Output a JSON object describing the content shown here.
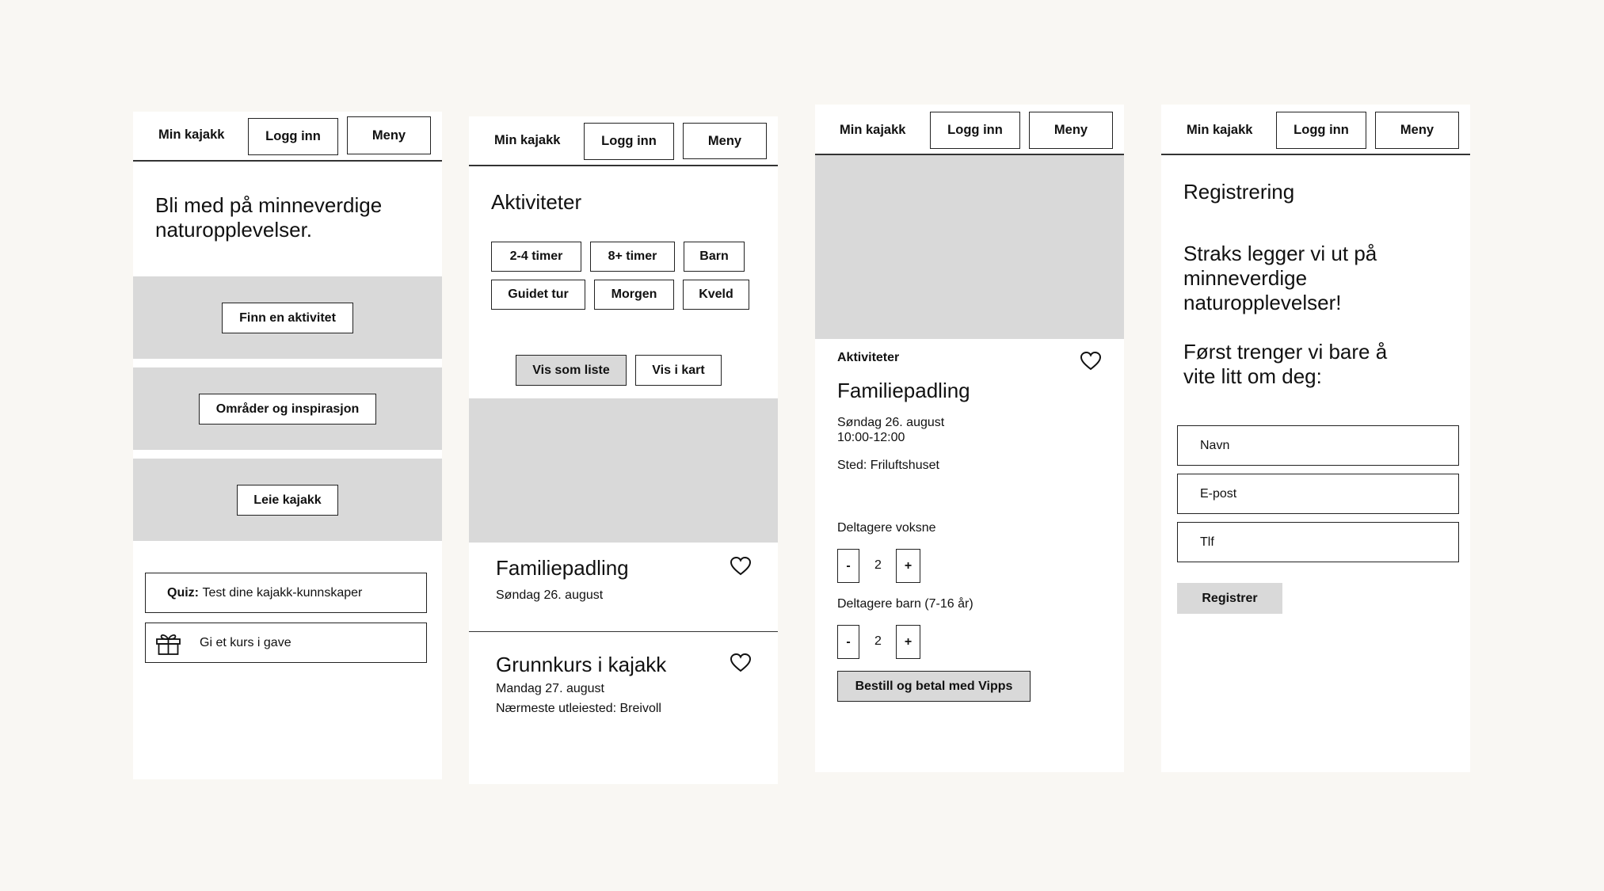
{
  "header": {
    "brand": "Min kajakk",
    "login": "Logg inn",
    "menu": "Meny"
  },
  "screen1": {
    "headline": "Bli med på minneverdige naturopplevelser.",
    "buttons": [
      "Finn en aktivitet",
      "Områder og inspirasjon",
      "Leie kajakk"
    ],
    "quiz_bold": "Quiz:",
    "quiz_text": "Test dine kajakk-kunnskaper",
    "gift_text": "Gi et kurs i gave"
  },
  "screen2": {
    "title": "Aktiviteter",
    "filters": [
      "2-4 timer",
      "8+ timer",
      "Barn",
      "Guidet tur",
      "Morgen",
      "Kveld"
    ],
    "view_list": "Vis som liste",
    "view_map": "Vis i kart",
    "cards": [
      {
        "title": "Familiepadling",
        "date": "Søndag 26. august",
        "extra": ""
      },
      {
        "title": "Grunnkurs i kajakk",
        "date": "Mandag 27. august",
        "extra": "Nærmeste utleiested: Breivoll"
      }
    ]
  },
  "screen3": {
    "breadcrumb": "Aktiviteter",
    "title": "Familiepadling",
    "date": "Søndag 26. august",
    "time": "10:00-12:00",
    "place": "Sted: Friluftshuset",
    "adults_label": "Deltagere voksne",
    "adults_value": "2",
    "children_label": "Deltagere barn (7-16 år)",
    "children_value": "2",
    "minus": "-",
    "plus": "+",
    "order_button": "Bestill og betal med Vipps"
  },
  "screen4": {
    "title": "Registrering",
    "intro1": "Straks legger vi ut på minneverdige naturopplevelser!",
    "intro2": "Først trenger vi bare å vite litt om deg:",
    "fields": [
      "Navn",
      "E-post",
      "Tlf"
    ],
    "submit": "Registrer"
  },
  "colors": {
    "background": "#f9f7f3",
    "placeholder_gray": "#d9d9d9",
    "border": "#222222"
  },
  "icons": {
    "heart": "heart-icon",
    "gift": "gift-icon"
  }
}
